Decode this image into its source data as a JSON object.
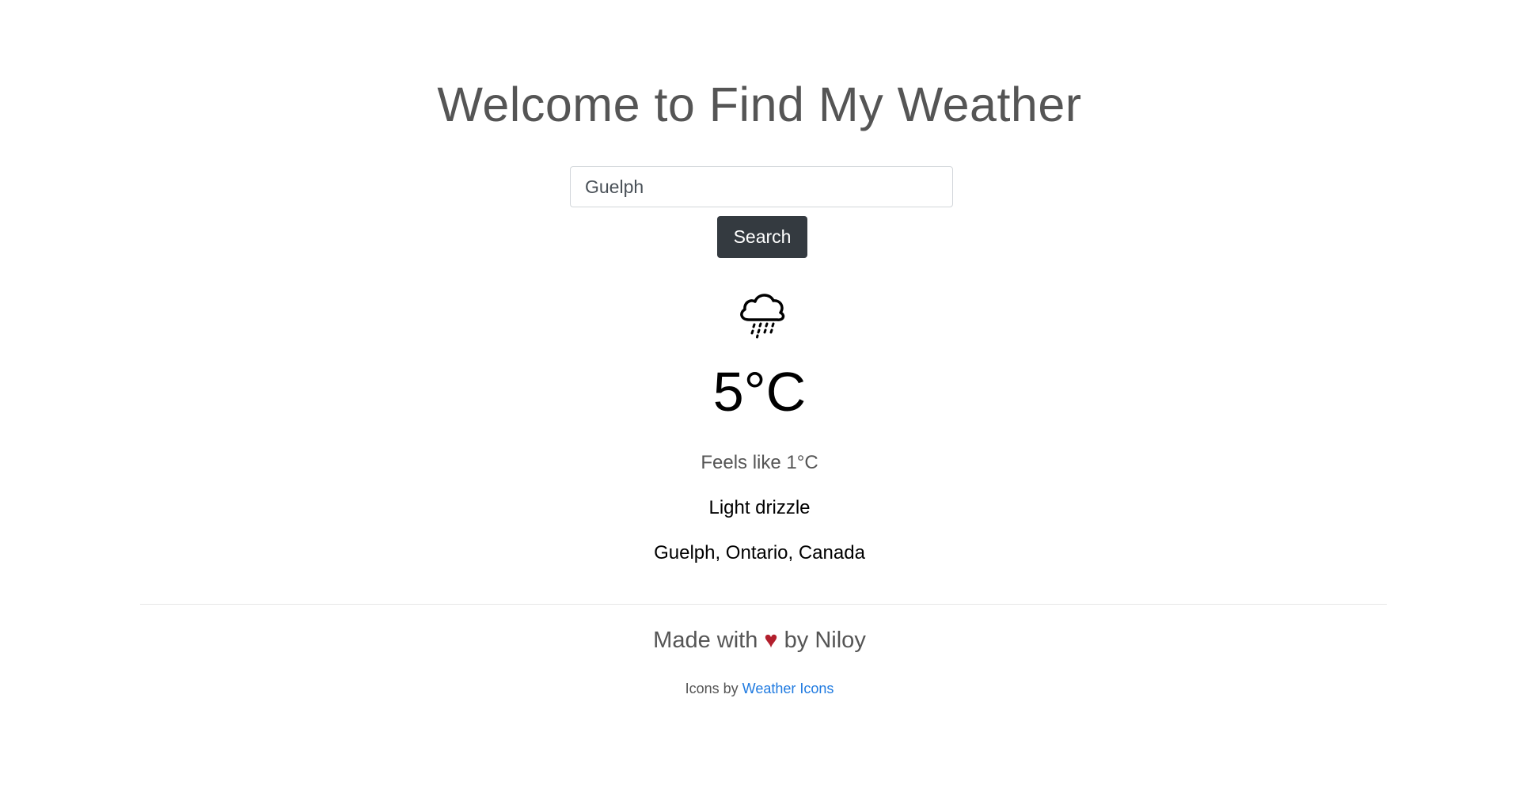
{
  "header": {
    "title": "Welcome to Find My Weather"
  },
  "search": {
    "value": "Guelph",
    "button_label": "Search"
  },
  "weather": {
    "icon": "rain-cloud-icon",
    "temperature": "5°C",
    "feels_like": "Feels like 1°C",
    "condition": "Light drizzle",
    "location": "Guelph, Ontario, Canada"
  },
  "footer": {
    "made_with_prefix": "Made with",
    "heart": "♥",
    "made_with_suffix": "by Niloy",
    "credits_prefix": "Icons by",
    "credits_link": "Weather Icons"
  },
  "colors": {
    "button_background": "#343a40",
    "heart": "#b21f2d",
    "link": "#1f7ae0"
  }
}
